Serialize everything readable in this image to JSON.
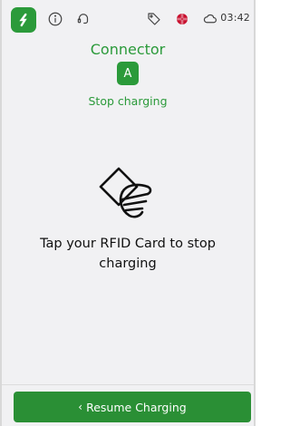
{
  "colors": {
    "brand_green": "#2b9a3a",
    "button_green": "#2a8f35",
    "flag_red": "#c8102e"
  },
  "statusbar": {
    "logo_icon": "brand-logo-icon",
    "icons": [
      "info-icon",
      "support-headset-icon",
      "price-tag-icon",
      "language-flag-icon",
      "cloud-icon"
    ],
    "time": "03:42"
  },
  "connector": {
    "title": "Connector",
    "id": "A",
    "status": "Stop charging"
  },
  "main": {
    "icon": "rfid-card-tap-icon",
    "instruction": "Tap your RFID Card to stop charging"
  },
  "footer": {
    "button_icon": "chevron-left-icon",
    "button_label": "Resume Charging"
  }
}
